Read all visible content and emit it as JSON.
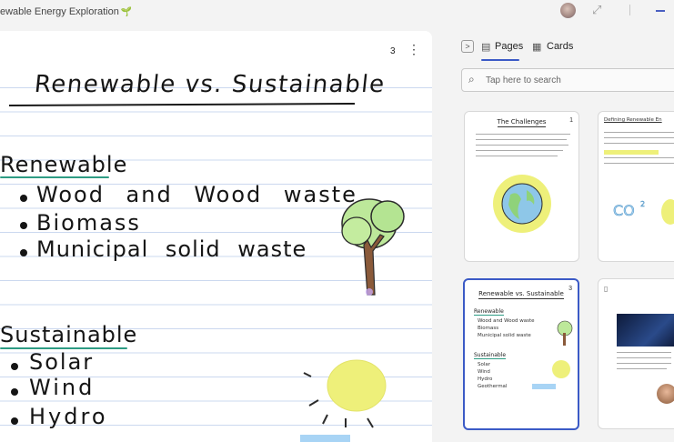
{
  "app": {
    "title": "ewable Energy Exploration"
  },
  "note": {
    "page_number": "3",
    "title": "Renewable vs. Sustainable",
    "sections": [
      {
        "heading": "Renewable",
        "items": [
          "Wood and Wood waste",
          "Biomass",
          "Municipal solid waste"
        ]
      },
      {
        "heading": "Sustainable",
        "items": [
          "Solar",
          "Wind",
          "Hydro"
        ]
      }
    ]
  },
  "panel": {
    "tabs": [
      {
        "label": "Pages",
        "selected": true
      },
      {
        "label": "Cards",
        "selected": false
      }
    ],
    "search": {
      "placeholder": "Tap here to search"
    },
    "cards": [
      {
        "title": "The Challenges",
        "number": "1",
        "active": false
      },
      {
        "title": "Defining Renewable En",
        "number": "",
        "active": false
      },
      {
        "title": "Renewable vs. Sustainable",
        "number": "3",
        "active": true,
        "mini_sections": [
          {
            "heading": "Renewable",
            "items": [
              "Wood and Wood waste",
              "Biomass",
              "Municipal solid waste"
            ]
          },
          {
            "heading": "Sustainable",
            "items": [
              "Solar",
              "Wind",
              "Hydro",
              "Geothermal"
            ]
          }
        ]
      },
      {
        "title": "",
        "number": "",
        "active": false
      }
    ]
  },
  "colors": {
    "accent": "#3b5ac6",
    "ink_underline": "#2e9c84",
    "rule_line": "#cbd8ef"
  }
}
